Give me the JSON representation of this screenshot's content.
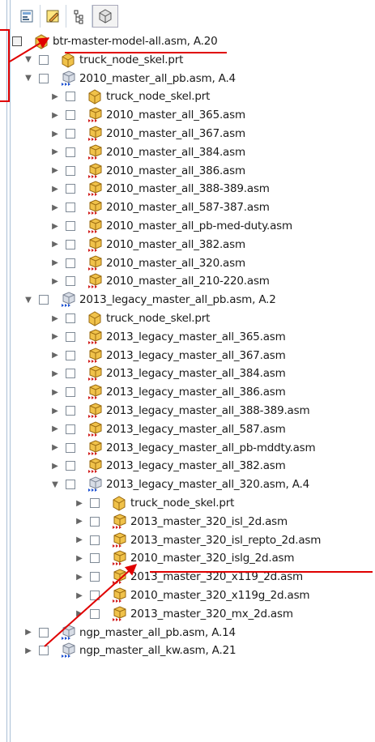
{
  "toolbar": {
    "buttons": [
      {
        "icon": "tree-config-icon"
      },
      {
        "icon": "edit-pencil-icon"
      },
      {
        "icon": "hierarchy-icon"
      },
      {
        "icon": "model-cube-icon"
      }
    ]
  },
  "tree": [
    {
      "label": "btr-master-model-all.asm, A.20",
      "depth": 0,
      "kind": "root"
    },
    {
      "label": "truck_node_skel.prt",
      "depth": 1,
      "kind": "part"
    },
    {
      "label": "2010_master_all_pb.asm, A.4",
      "depth": 1,
      "kind": "asm-open"
    },
    {
      "label": "truck_node_skel.prt",
      "depth": 2,
      "kind": "part"
    },
    {
      "label": "2010_master_all_365.asm",
      "depth": 2,
      "kind": "asm"
    },
    {
      "label": "2010_master_all_367.asm",
      "depth": 2,
      "kind": "asm"
    },
    {
      "label": "2010_master_all_384.asm",
      "depth": 2,
      "kind": "asm"
    },
    {
      "label": "2010_master_all_386.asm",
      "depth": 2,
      "kind": "asm"
    },
    {
      "label": "2010_master_all_388-389.asm",
      "depth": 2,
      "kind": "asm"
    },
    {
      "label": "2010_master_all_587-387.asm",
      "depth": 2,
      "kind": "asm"
    },
    {
      "label": "2010_master_all_pb-med-duty.asm",
      "depth": 2,
      "kind": "asm"
    },
    {
      "label": "2010_master_all_382.asm",
      "depth": 2,
      "kind": "asm"
    },
    {
      "label": "2010_master_all_320.asm",
      "depth": 2,
      "kind": "asm"
    },
    {
      "label": "2010_master_all_210-220.asm",
      "depth": 2,
      "kind": "asm"
    },
    {
      "label": "2013_legacy_master_all_pb.asm, A.2",
      "depth": 1,
      "kind": "asm-open"
    },
    {
      "label": "truck_node_skel.prt",
      "depth": 2,
      "kind": "part"
    },
    {
      "label": "2013_legacy_master_all_365.asm",
      "depth": 2,
      "kind": "asm"
    },
    {
      "label": "2013_legacy_master_all_367.asm",
      "depth": 2,
      "kind": "asm"
    },
    {
      "label": "2013_legacy_master_all_384.asm",
      "depth": 2,
      "kind": "asm"
    },
    {
      "label": "2013_legacy_master_all_386.asm",
      "depth": 2,
      "kind": "asm"
    },
    {
      "label": "2013_legacy_master_all_388-389.asm",
      "depth": 2,
      "kind": "asm"
    },
    {
      "label": "2013_legacy_master_all_587.asm",
      "depth": 2,
      "kind": "asm"
    },
    {
      "label": "2013_legacy_master_all_pb-mddty.asm",
      "depth": 2,
      "kind": "asm"
    },
    {
      "label": "2013_legacy_master_all_382.asm",
      "depth": 2,
      "kind": "asm"
    },
    {
      "label": "2013_legacy_master_all_320.asm, A.4",
      "depth": 2,
      "kind": "asm-open"
    },
    {
      "label": "truck_node_skel.prt",
      "depth": 3,
      "kind": "part"
    },
    {
      "label": "2013_master_320_isl_2d.asm",
      "depth": 3,
      "kind": "asm"
    },
    {
      "label": "2013_master_320_isl_repto_2d.asm",
      "depth": 3,
      "kind": "asm"
    },
    {
      "label": "2010_master_320_islg_2d.asm",
      "depth": 3,
      "kind": "asm"
    },
    {
      "label": "2013_master_320_x119_2d.asm",
      "depth": 3,
      "kind": "asm"
    },
    {
      "label": "2010_master_320_x119g_2d.asm",
      "depth": 3,
      "kind": "asm"
    },
    {
      "label": "2013_master_320_mx_2d.asm",
      "depth": 3,
      "kind": "asm"
    },
    {
      "label": "ngp_master_all_pb.asm, A.14",
      "depth": 1,
      "kind": "asm-closed"
    },
    {
      "label": "ngp_master_all_kw.asm, A.21",
      "depth": 1,
      "kind": "asm-closed"
    }
  ],
  "colors": {
    "annotation": "#e00000",
    "part_gold": "#e8b43a",
    "asm_red": "#d11a1a"
  }
}
